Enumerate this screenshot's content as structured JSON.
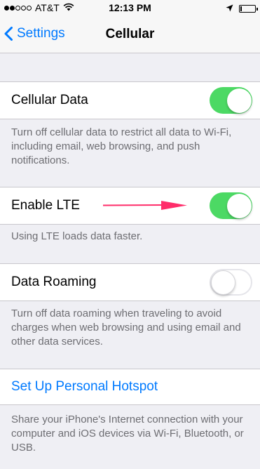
{
  "status_bar": {
    "carrier": "AT&T",
    "time": "12:13 PM",
    "signal_bars_filled": 2,
    "signal_bars_total": 5,
    "battery_level": 0.1
  },
  "nav": {
    "back_label": "Settings",
    "title": "Cellular"
  },
  "settings": {
    "cellular_data": {
      "label": "Cellular Data",
      "enabled": true,
      "footer": "Turn off cellular data to restrict all data to Wi-Fi, including email, web browsing, and push notifications."
    },
    "enable_lte": {
      "label": "Enable LTE",
      "enabled": true,
      "footer": "Using LTE loads data faster."
    },
    "data_roaming": {
      "label": "Data Roaming",
      "enabled": false,
      "footer": "Turn off data roaming when traveling to avoid charges when web browsing and using email and other data services."
    },
    "hotspot": {
      "label": "Set Up Personal Hotspot",
      "footer": "Share your iPhone's Internet connection with your computer and iOS devices via Wi-Fi, Bluetooth, or USB."
    }
  },
  "colors": {
    "accent": "#007aff",
    "toggle_on": "#4cd964",
    "annotation_arrow": "#ff2d6a"
  },
  "icons": [
    "wifi-icon",
    "location-arrow-icon",
    "battery-icon",
    "back-chevron-icon",
    "annotation-arrow"
  ]
}
